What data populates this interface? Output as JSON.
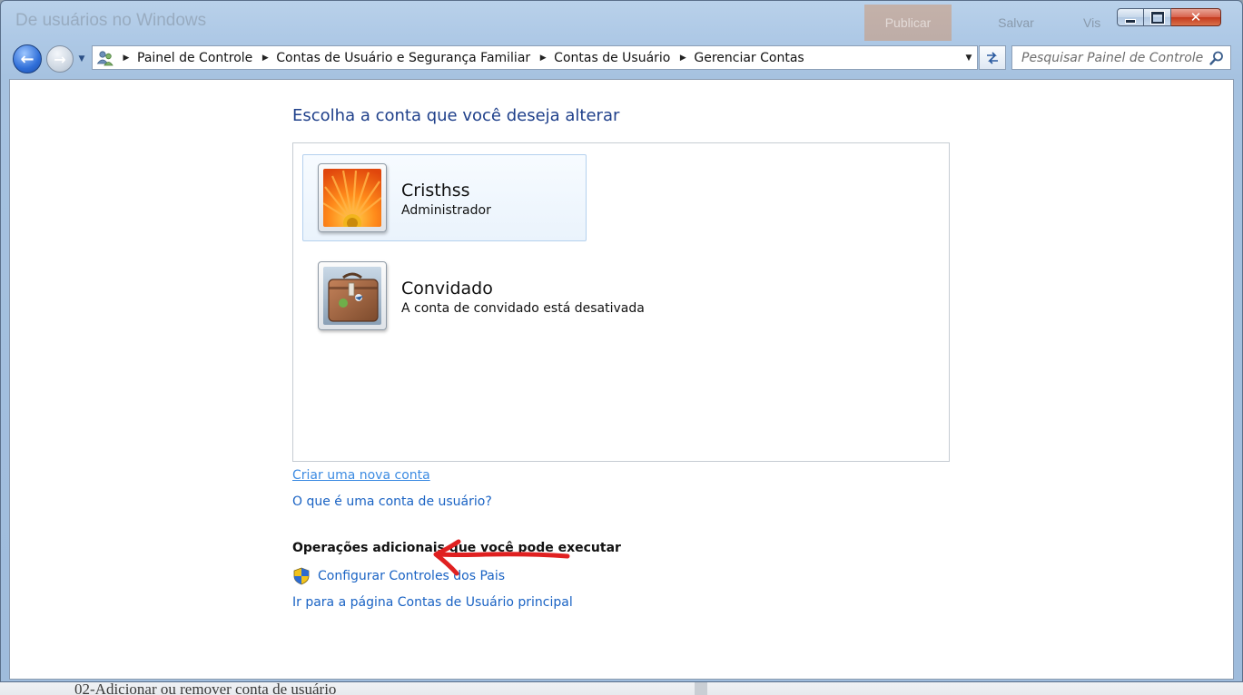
{
  "background_doc": {
    "title_ghost": "De usuários no Windows",
    "publish": "Publicar",
    "save": "Salvar",
    "view": "Vis",
    "bottom_text": "02-Adicionar ou remover conta de usuário"
  },
  "window_controls": {
    "minimize_icon": "minimize-icon",
    "maximize_icon": "maximize-icon",
    "close_icon": "close-icon",
    "close_glyph": "✕"
  },
  "nav": {
    "back_glyph": "←",
    "forward_glyph": "→",
    "breadcrumbs": [
      "Painel de Controle",
      "Contas de Usuário e Segurança Familiar",
      "Contas de Usuário",
      "Gerenciar Contas"
    ],
    "search_placeholder": "Pesquisar Painel de Controle"
  },
  "content": {
    "title": "Escolha a conta que você deseja alterar",
    "accounts": [
      {
        "name": "Cristhss",
        "type": "Administrador",
        "picture": "flower-picture",
        "selected": true
      },
      {
        "name": "Convidado",
        "type": "A conta de convidado está desativada",
        "picture": "suitcase-picture",
        "selected": false
      }
    ],
    "create_link": "Criar uma nova conta",
    "what_link": "O que é uma conta de usuário?",
    "additional_heading": "Operações adicionais que você pode executar",
    "parental_link": "Configurar Controles dos Pais",
    "main_page_link": "Ir para a página Contas de Usuário principal"
  },
  "colors": {
    "title_blue": "#1e3f8a",
    "link_blue": "#1a63c4",
    "annotation_red": "#e02020"
  }
}
